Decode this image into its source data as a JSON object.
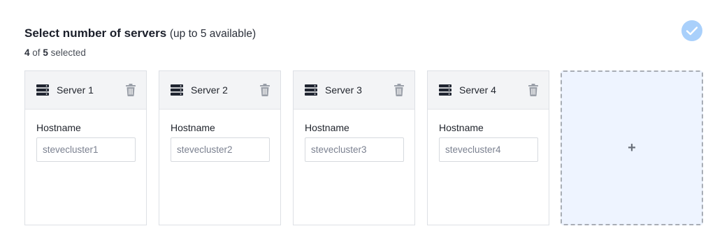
{
  "header": {
    "title": "Select number of servers",
    "title_note": "(up to 5 available)",
    "selected_count": "4",
    "of_text": "of",
    "total_count": "5",
    "selected_text": "selected"
  },
  "status": {
    "icon": "check-icon",
    "color": "#a9d0fb"
  },
  "servers": [
    {
      "title": "Server 1",
      "field_label": "Hostname",
      "hostname": "stevecluster1"
    },
    {
      "title": "Server 2",
      "field_label": "Hostname",
      "hostname": "stevecluster2"
    },
    {
      "title": "Server 3",
      "field_label": "Hostname",
      "hostname": "stevecluster3"
    },
    {
      "title": "Server 4",
      "field_label": "Hostname",
      "hostname": "stevecluster4"
    }
  ],
  "add_card": {
    "label": "+"
  },
  "icons": {
    "server": "server-icon",
    "delete": "trash-icon"
  }
}
